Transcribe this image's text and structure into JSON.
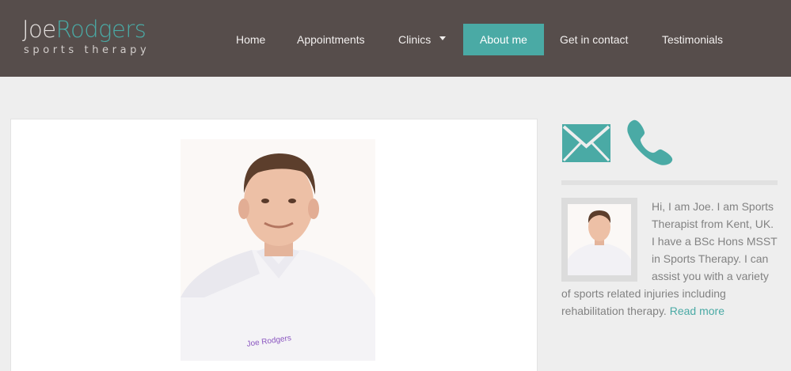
{
  "logo": {
    "first": "Joe",
    "last": "Rodgers",
    "tagline": "sports therapy"
  },
  "nav": {
    "items": [
      {
        "label": "Home"
      },
      {
        "label": "Appointments"
      },
      {
        "label": "Clinics"
      },
      {
        "label": "About me"
      },
      {
        "label": "Get in contact"
      },
      {
        "label": "Testimonials"
      }
    ],
    "active_label": "About me"
  },
  "main": {
    "photo_shirt_text": "Joe Rodgers"
  },
  "sidebar": {
    "contact_icons": [
      "mail-icon",
      "phone-icon"
    ],
    "about_text": "Hi, I am Joe. I am Sports Therapist from Kent, UK. I have a BSc Hons MSST in Sports Therapy. I can assist you with a variety of sports related injuries including rehabilitation therapy.",
    "read_more": "Read more"
  },
  "colors": {
    "header_bg": "#564d4b",
    "accent": "#4aaaa5",
    "page_bg": "#eeeeee",
    "body_text": "#828282"
  }
}
